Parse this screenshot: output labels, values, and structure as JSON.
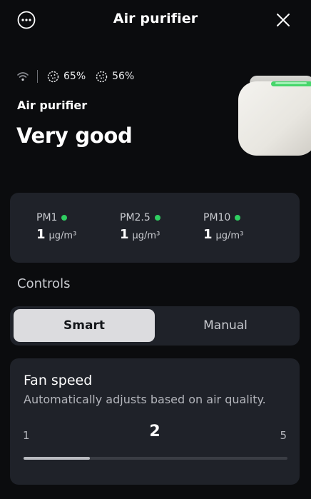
{
  "header": {
    "title": "Air purifier",
    "more_icon": "more-horizontal-icon",
    "close_icon": "close-icon"
  },
  "status": {
    "wifi_icon": "wifi-icon",
    "filters": [
      {
        "icon": "filter-icon",
        "value": "65%"
      },
      {
        "icon": "filter-icon",
        "value": "56%"
      }
    ]
  },
  "device": {
    "name": "Air purifier",
    "air_quality": "Very good"
  },
  "pm": {
    "items": [
      {
        "label": "PM1",
        "value": "1",
        "unit": "μg/m³",
        "status_color": "#2fcf61"
      },
      {
        "label": "PM2.5",
        "value": "1",
        "unit": "μg/m³",
        "status_color": "#2fcf61"
      },
      {
        "label": "PM10",
        "value": "1",
        "unit": "μg/m³",
        "status_color": "#2fcf61"
      }
    ]
  },
  "controls": {
    "heading": "Controls",
    "modes": [
      "Smart",
      "Manual"
    ],
    "selected_mode": "Smart"
  },
  "fan": {
    "title": "Fan speed",
    "subtitle": "Automatically adjusts based on air quality.",
    "min": "1",
    "max": "5",
    "value": "2",
    "level_fraction": 0.25
  },
  "colors": {
    "background": "#0b0c0e",
    "card": "#1f2229",
    "good": "#2fcf61",
    "device_light": "#46d66a"
  }
}
